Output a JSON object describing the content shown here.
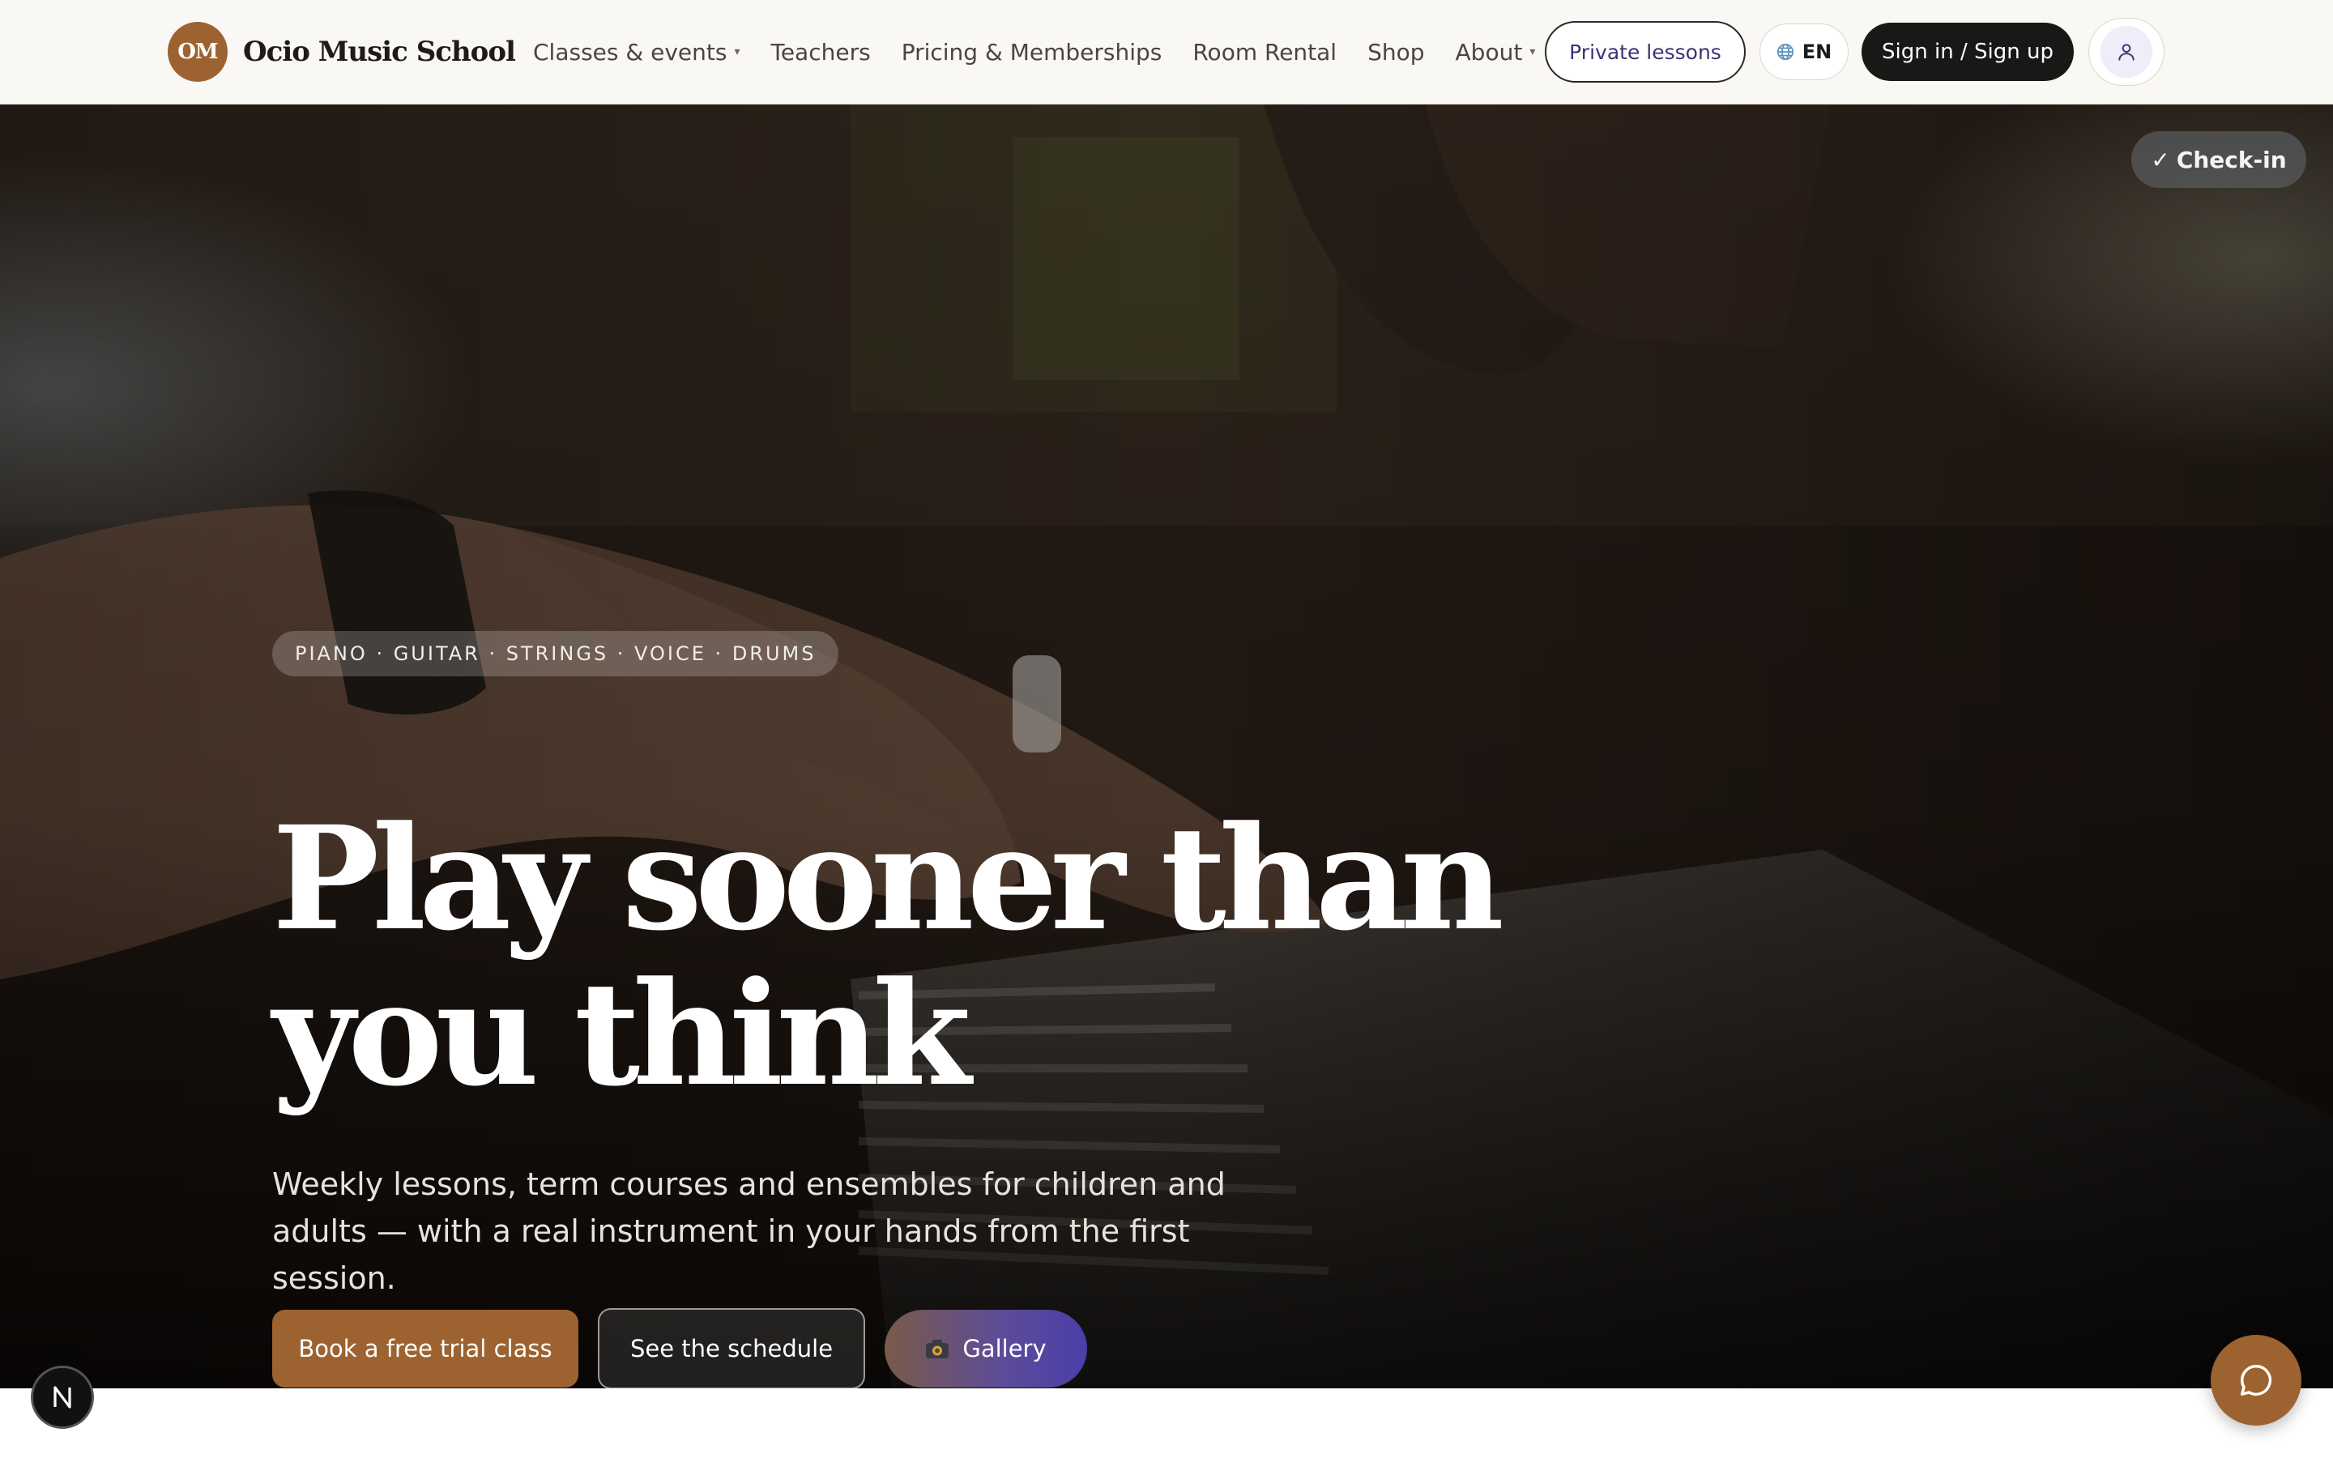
{
  "nav": {
    "logo_text": "OM",
    "brand": "Ocio Music School",
    "links": [
      {
        "label": "Classes & events",
        "has_caret": true
      },
      {
        "label": "Teachers",
        "has_caret": false
      },
      {
        "label": "Pricing & Memberships",
        "has_caret": false
      },
      {
        "label": "Room Rental",
        "has_caret": false
      },
      {
        "label": "Shop",
        "has_caret": false
      },
      {
        "label": "About",
        "has_caret": true
      }
    ],
    "caret_glyph": "▾",
    "private_lessons": "Private lessons",
    "language": "EN",
    "sign_in": "Sign in / Sign up",
    "icons": {
      "language": "globe-icon",
      "user": "user-icon"
    }
  },
  "hero": {
    "checkin": "Check-in",
    "checkin_glyph": "✓",
    "tag": "PIANO · GUITAR · STRINGS · VOICE · DRUMS",
    "headline": "Play sooner than you think",
    "subtext": "Weekly lessons, term courses and ensembles for children and adults — with a real instrument in your hands from the first session.",
    "cta_primary": "Book a free trial class",
    "cta_secondary": "See the schedule",
    "cta_gallery": "Gallery",
    "background": "piano-hands-photo"
  },
  "floating": {
    "n_badge": "N",
    "chat_icon": "chat-bubble-icon"
  },
  "colors": {
    "accent": "#9c6330",
    "nav_bg": "#faf8f4",
    "dark_button": "#1a1816",
    "private_text": "#3b3274",
    "gallery_purple": "#4a3fa8"
  }
}
